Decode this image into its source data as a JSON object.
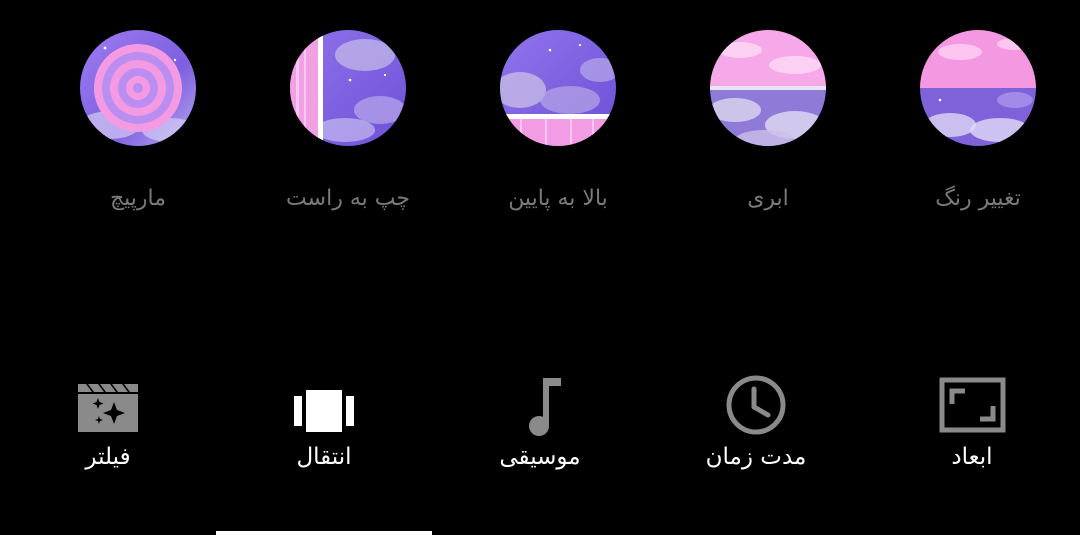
{
  "colors": {
    "background": "#000000",
    "effect_label": "#7a7a7a",
    "tool_label": "#ffffff",
    "icon_gray": "#8a8a8a",
    "icon_active": "#ffffff",
    "pink": "#f08ee0",
    "purple": "#8a6ae8",
    "lavender": "#b7a6ea"
  },
  "effects": [
    {
      "label": "مارپیچ",
      "thumbnail": "spiral-thumbnail"
    },
    {
      "label": "چپ به راست",
      "thumbnail": "left-to-right-thumbnail"
    },
    {
      "label": "بالا به پایین",
      "thumbnail": "top-to-bottom-thumbnail"
    },
    {
      "label": "ابری",
      "thumbnail": "cloud-thumbnail"
    },
    {
      "label": "تغییر رنگ",
      "thumbnail": "color-change-thumbnail"
    }
  ],
  "toolbar": {
    "selected": "transition",
    "items": [
      {
        "label": "فیلتر",
        "icon": "filter-icon"
      },
      {
        "label": "انتقال",
        "icon": "transition-icon"
      },
      {
        "label": "موسیقی",
        "icon": "music-note-icon"
      },
      {
        "label": "مدت زمان",
        "icon": "clock-icon"
      },
      {
        "label": "ابعاد",
        "icon": "aspect-ratio-icon"
      }
    ]
  }
}
